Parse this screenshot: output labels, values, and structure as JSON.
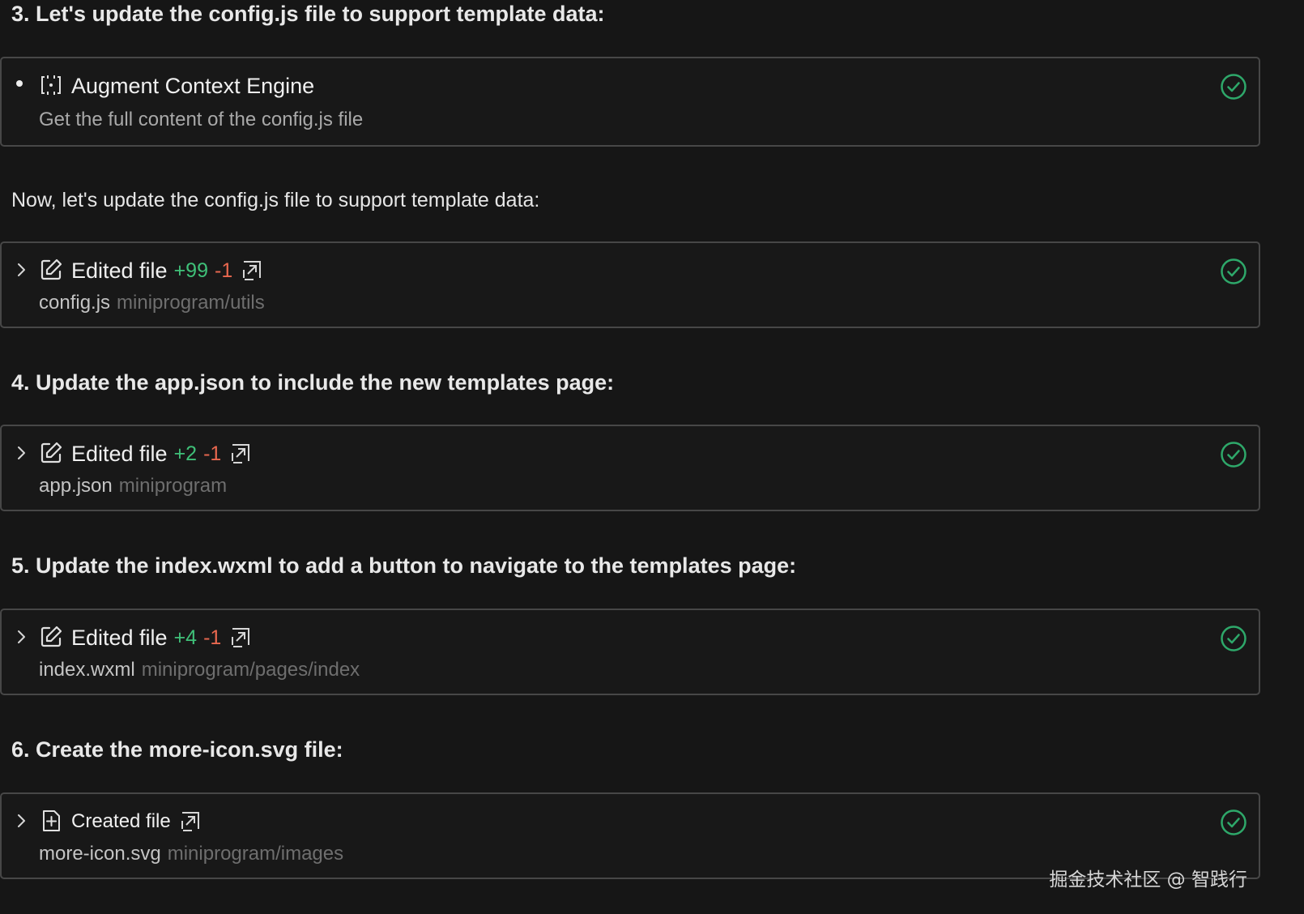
{
  "sections": {
    "step3_heading": "3. Let's update the config.js file to support template data:",
    "intro_paragraph": "Now, let's update the config.js file to support template data:",
    "step4_heading": "4. Update the app.json to include the new templates page:",
    "step5_heading": "5. Update the index.wxml to add a button to navigate to the templates page:",
    "step6_heading": "6. Create the more-icon.svg file:"
  },
  "cards": {
    "context": {
      "title": "Augment Context Engine",
      "description": "Get the full content of the config.js file",
      "icon": "context-engine-icon",
      "status": "success"
    },
    "config": {
      "title": "Edited file",
      "added": "+99",
      "removed": "-1",
      "filename": "config.js",
      "path": "miniprogram/utils",
      "icon": "edit-icon",
      "status": "success"
    },
    "appjson": {
      "title": "Edited file",
      "added": "+2",
      "removed": "-1",
      "filename": "app.json",
      "path": "miniprogram",
      "icon": "edit-icon",
      "status": "success"
    },
    "index": {
      "title": "Edited file",
      "added": "+4",
      "removed": "-1",
      "filename": "index.wxml",
      "path": "miniprogram/pages/index",
      "icon": "edit-icon",
      "status": "success"
    },
    "moreicon": {
      "title": "Created file",
      "filename": "more-icon.svg",
      "path": "miniprogram/images",
      "icon": "new-file-icon",
      "status": "success"
    }
  },
  "watermark": "掘金技术社区 @ 智践行",
  "colors": {
    "background": "#161616",
    "card_border": "#474747",
    "added": "#3fc078",
    "removed": "#e8674f",
    "success": "#2ea86a",
    "path_muted": "#6e6e6e"
  }
}
